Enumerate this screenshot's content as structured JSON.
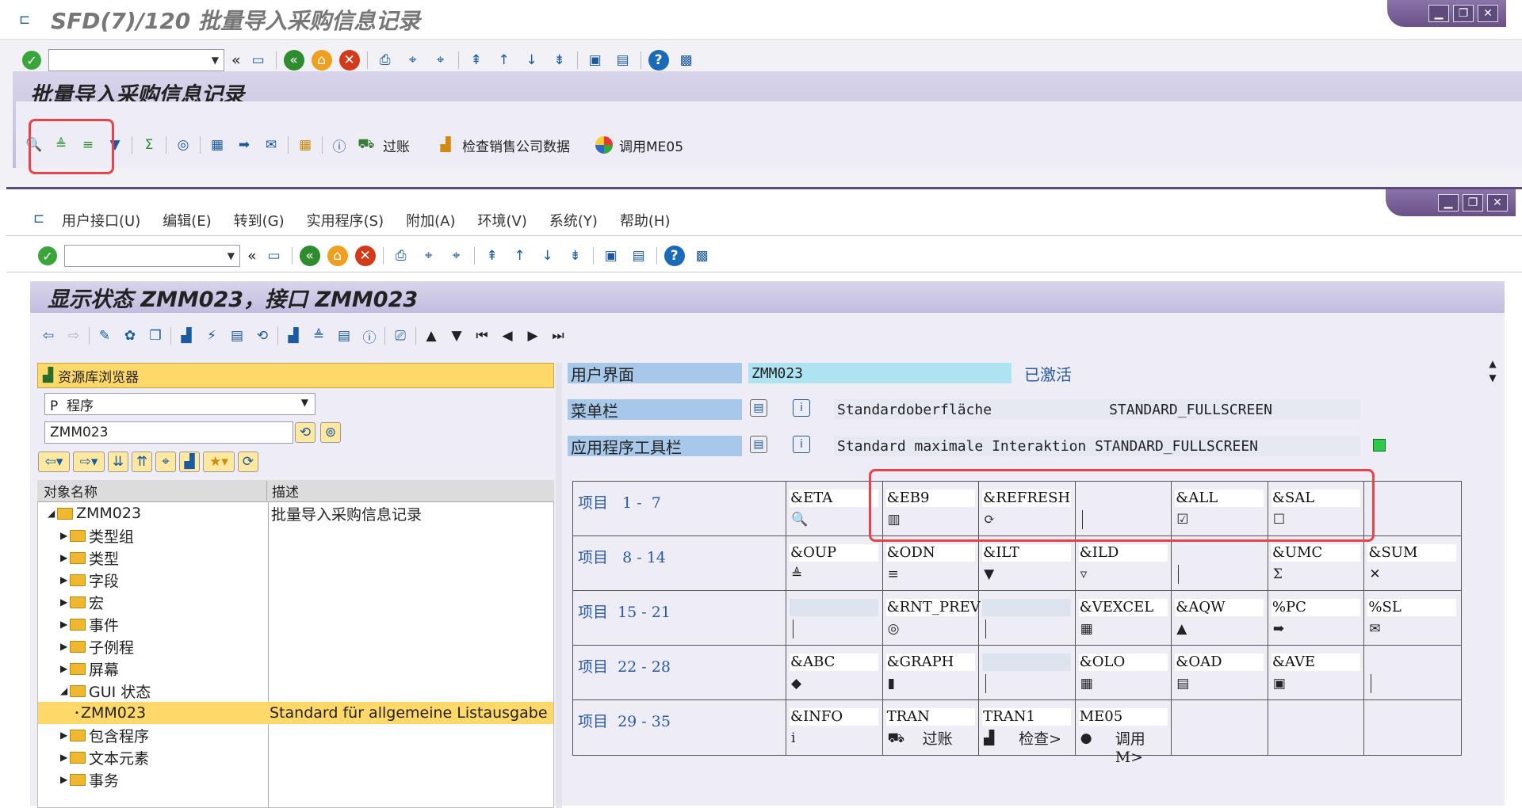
{
  "win1": {
    "title": "SFD(7)/120 批量导入采购信息记录",
    "header": "批量导入采购信息记录",
    "toolbar": {
      "post": "过账",
      "check": "检查销售公司数据",
      "call": "调用ME05"
    }
  },
  "win2": {
    "menu": [
      "用户接口(U)",
      "编辑(E)",
      "转到(G)",
      "实用程序(S)",
      "附加(A)",
      "环境(V)",
      "系统(Y)",
      "帮助(H)"
    ],
    "header": "显示状态 ZMM023，接口 ZMM023",
    "nav": {
      "browser": "资源库浏览器",
      "type_value": "P  程序",
      "obj_value": "ZMM023"
    },
    "tree": {
      "col1": "对象名称",
      "col2": "描述",
      "rows": [
        {
          "name": "ZMM023",
          "desc": "批量导入采购信息记录"
        },
        {
          "name": "类型组"
        },
        {
          "name": "类型"
        },
        {
          "name": "字段"
        },
        {
          "name": "宏"
        },
        {
          "name": "事件"
        },
        {
          "name": "子例程"
        },
        {
          "name": "屏幕"
        },
        {
          "name": "GUI 状态"
        },
        {
          "name": "ZMM023",
          "desc": "Standard für allgemeine Listausgabe"
        },
        {
          "name": "包含程序"
        },
        {
          "name": "文本元素"
        },
        {
          "name": "事务"
        }
      ]
    },
    "ui": {
      "l1": "用户界面",
      "v1": "ZMM023",
      "s1": "已激活",
      "l2": "菜单栏",
      "v2a": "Standardoberfläche",
      "v2b": "STANDARD_FULLSCREEN",
      "l3": "应用程序工具栏",
      "v3": "Standard maximale Interaktion STANDARD_FULLSCREEN"
    },
    "grid": [
      {
        "label": "项目   1 -  7",
        "cells": [
          {
            "code": "&ETA",
            "icon": "🔍"
          },
          {
            "code": "&EB9",
            "icon": "▥"
          },
          {
            "code": "&REFRESH",
            "icon": "⟳"
          },
          {
            "pipe": true
          },
          {
            "code": "&ALL",
            "icon": "☑"
          },
          {
            "code": "&SAL",
            "icon": "☐"
          },
          {
            "blank": false
          }
        ]
      },
      {
        "label": "项目   8 - 14",
        "cells": [
          {
            "code": "&OUP",
            "icon": "≜"
          },
          {
            "code": "&ODN",
            "icon": "≡"
          },
          {
            "code": "&ILT",
            "icon": "▼"
          },
          {
            "code": "&ILD",
            "icon": "▿"
          },
          {
            "pipe": true
          },
          {
            "code": "&UMC",
            "icon": "Σ"
          },
          {
            "code": "&SUM",
            "icon": "✕"
          }
        ]
      },
      {
        "label": "项目  15 - 21",
        "cells": [
          {
            "blank": true,
            "pipe": true
          },
          {
            "code": "&RNT_PREV",
            "icon": "◎"
          },
          {
            "blank": true,
            "pipe": true
          },
          {
            "code": "&VEXCEL",
            "icon": "▦"
          },
          {
            "code": "&AQW",
            "icon": "▲"
          },
          {
            "code": "%PC",
            "icon": "➡"
          },
          {
            "code": "%SL",
            "icon": "✉"
          }
        ]
      },
      {
        "label": "项目  22 - 28",
        "cells": [
          {
            "code": "&ABC",
            "icon": "◆"
          },
          {
            "code": "&GRAPH",
            "icon": "▮"
          },
          {
            "blank": true,
            "pipe": true
          },
          {
            "code": "&OLO",
            "icon": "▦"
          },
          {
            "code": "&OAD",
            "icon": "▤"
          },
          {
            "code": "&AVE",
            "icon": "▣"
          },
          {
            "pipe": true
          }
        ]
      },
      {
        "label": "项目  29 - 35",
        "cells": [
          {
            "code": "&INFO",
            "icon": "i"
          },
          {
            "code": "TRAN",
            "icon": "⛟",
            "text": "过账"
          },
          {
            "code": "TRAN1",
            "icon": "▟",
            "text": "检查>"
          },
          {
            "code": "ME05",
            "icon": "●",
            "text": "调用M>"
          },
          {},
          {},
          {}
        ]
      }
    ]
  }
}
